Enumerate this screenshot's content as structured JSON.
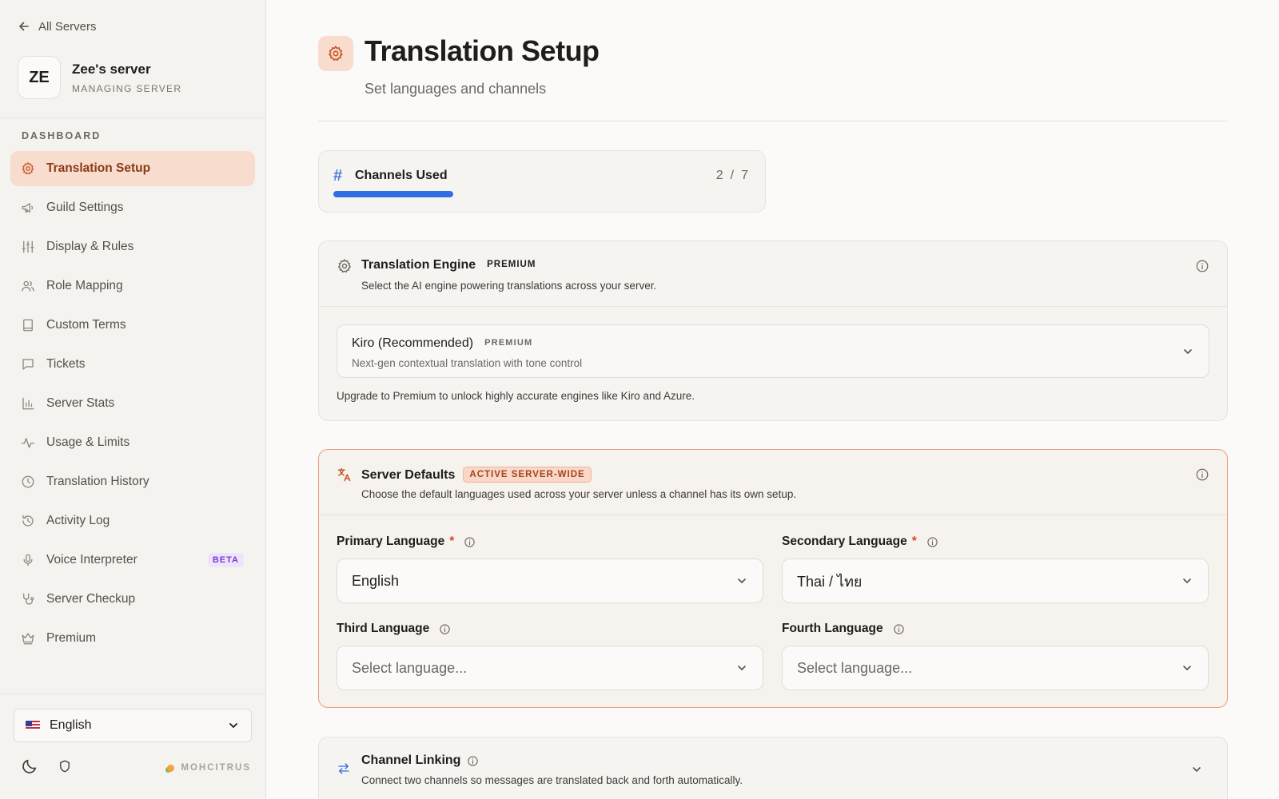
{
  "sidebar": {
    "back_label": "All Servers",
    "server": {
      "initials": "ZE",
      "name": "Zee's server",
      "subtitle": "MANAGING SERVER"
    },
    "section_label": "DASHBOARD",
    "items": [
      {
        "label": "Translation Setup",
        "icon": "gear-icon",
        "active": true
      },
      {
        "label": "Guild Settings",
        "icon": "megaphone-icon"
      },
      {
        "label": "Display & Rules",
        "icon": "sliders-icon"
      },
      {
        "label": "Role Mapping",
        "icon": "users-icon"
      },
      {
        "label": "Custom Terms",
        "icon": "book-icon"
      },
      {
        "label": "Tickets",
        "icon": "chat-icon"
      },
      {
        "label": "Server Stats",
        "icon": "bar-chart-icon"
      },
      {
        "label": "Usage & Limits",
        "icon": "activity-icon"
      },
      {
        "label": "Translation History",
        "icon": "clock-icon"
      },
      {
        "label": "Activity Log",
        "icon": "history-icon"
      },
      {
        "label": "Voice Interpreter",
        "icon": "microphone-icon",
        "badge": "BETA"
      },
      {
        "label": "Server Checkup",
        "icon": "stethoscope-icon"
      },
      {
        "label": "Premium",
        "icon": "crown-icon"
      }
    ],
    "language": {
      "label": "English",
      "icon": "us-flag-icon"
    },
    "brand": "MOHCITRUS"
  },
  "header": {
    "title": "Translation Setup",
    "subtitle": "Set languages and channels"
  },
  "channels": {
    "title": "Channels Used",
    "used": "2",
    "separator": "/",
    "total": "7",
    "progress_fraction": 0.2857
  },
  "engine": {
    "title": "Translation Engine",
    "tag": "PREMIUM",
    "description": "Select the AI engine powering translations across your server.",
    "selected": {
      "name": "Kiro (Recommended)",
      "tag": "PREMIUM",
      "description": "Next-gen contextual translation with tone control"
    },
    "note": "Upgrade to Premium to unlock highly accurate engines like Kiro and Azure."
  },
  "defaults": {
    "title": "Server Defaults",
    "tag": "ACTIVE SERVER-WIDE",
    "description": "Choose the default languages used across your server unless a channel has its own setup.",
    "primary": {
      "label": "Primary Language",
      "required": "*",
      "value": "English"
    },
    "secondary": {
      "label": "Secondary Language",
      "required": "*",
      "value": "Thai / ไทย"
    },
    "third": {
      "label": "Third Language",
      "placeholder": "Select language..."
    },
    "fourth": {
      "label": "Fourth Language",
      "placeholder": "Select language..."
    }
  },
  "linking": {
    "title": "Channel Linking",
    "description": "Connect two channels so messages are translated back and forth automatically."
  },
  "colors": {
    "accent": "#c8562a",
    "active_bg": "#f8dccd",
    "progress": "#2f6fe4",
    "beta": "#7b3ad8"
  }
}
